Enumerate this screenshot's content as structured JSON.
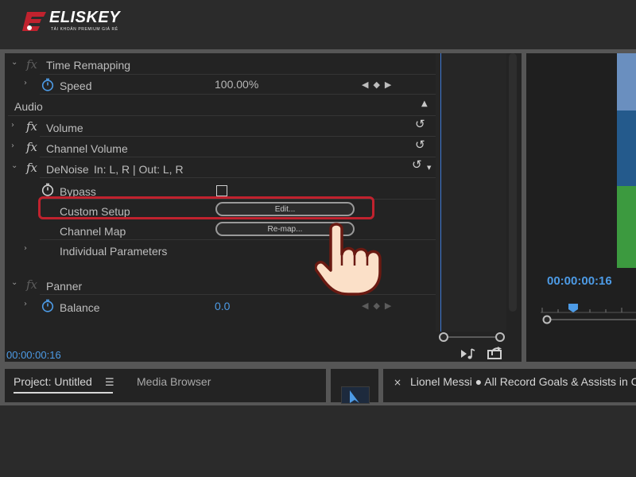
{
  "brand": {
    "name": "ELISKEY",
    "tagline": "TÀI KHOẢN PREMIUM GIÁ RẺ",
    "accent": "#c0222e"
  },
  "effect_controls": {
    "rows": [
      {
        "id": "time-remapping",
        "label": "Time Remapping",
        "has_fx": true,
        "fx_dim": true,
        "expanded": true
      },
      {
        "id": "speed",
        "label": "Speed",
        "value": "100.00%"
      },
      {
        "id": "audio-header",
        "label": "Audio"
      },
      {
        "id": "volume",
        "label": "Volume"
      },
      {
        "id": "channel-volume",
        "label": "Channel Volume"
      },
      {
        "id": "denoise",
        "label": "DeNoise",
        "detail": "In: L, R | Out: L, R"
      },
      {
        "id": "bypass",
        "label": "Bypass"
      },
      {
        "id": "custom-setup",
        "label": "Custom Setup",
        "button": "Edit..."
      },
      {
        "id": "channel-map",
        "label": "Channel Map",
        "button": "Re-map..."
      },
      {
        "id": "individual-parameters",
        "label": "Individual Parameters"
      },
      {
        "id": "panner",
        "label": "Panner"
      },
      {
        "id": "balance",
        "label": "Balance",
        "value": "0.0"
      }
    ],
    "timecode": "00:00:00:16"
  },
  "program_monitor": {
    "timecode": "00:00:00:16"
  },
  "bottom_panel": {
    "project_tab": "Project: Untitled",
    "media_browser_tab": "Media Browser",
    "sequence_close": "×",
    "sequence_title": "Lionel  Messi ● All Record Goals & Assists in C"
  },
  "icons": [
    "eliskey-logo-icon",
    "stopwatch-icon",
    "fx-icon",
    "reset-icon",
    "chevron-right-icon",
    "chevron-down-icon",
    "keyframe-nav-icon",
    "hand-pointer-icon",
    "hamburger-menu-icon",
    "selection-tool-icon",
    "play-audio-icon",
    "export-icon"
  ],
  "colors": {
    "timecode": "#4d9be6",
    "highlight": "#c0222e",
    "panel_bg": "#232323"
  }
}
